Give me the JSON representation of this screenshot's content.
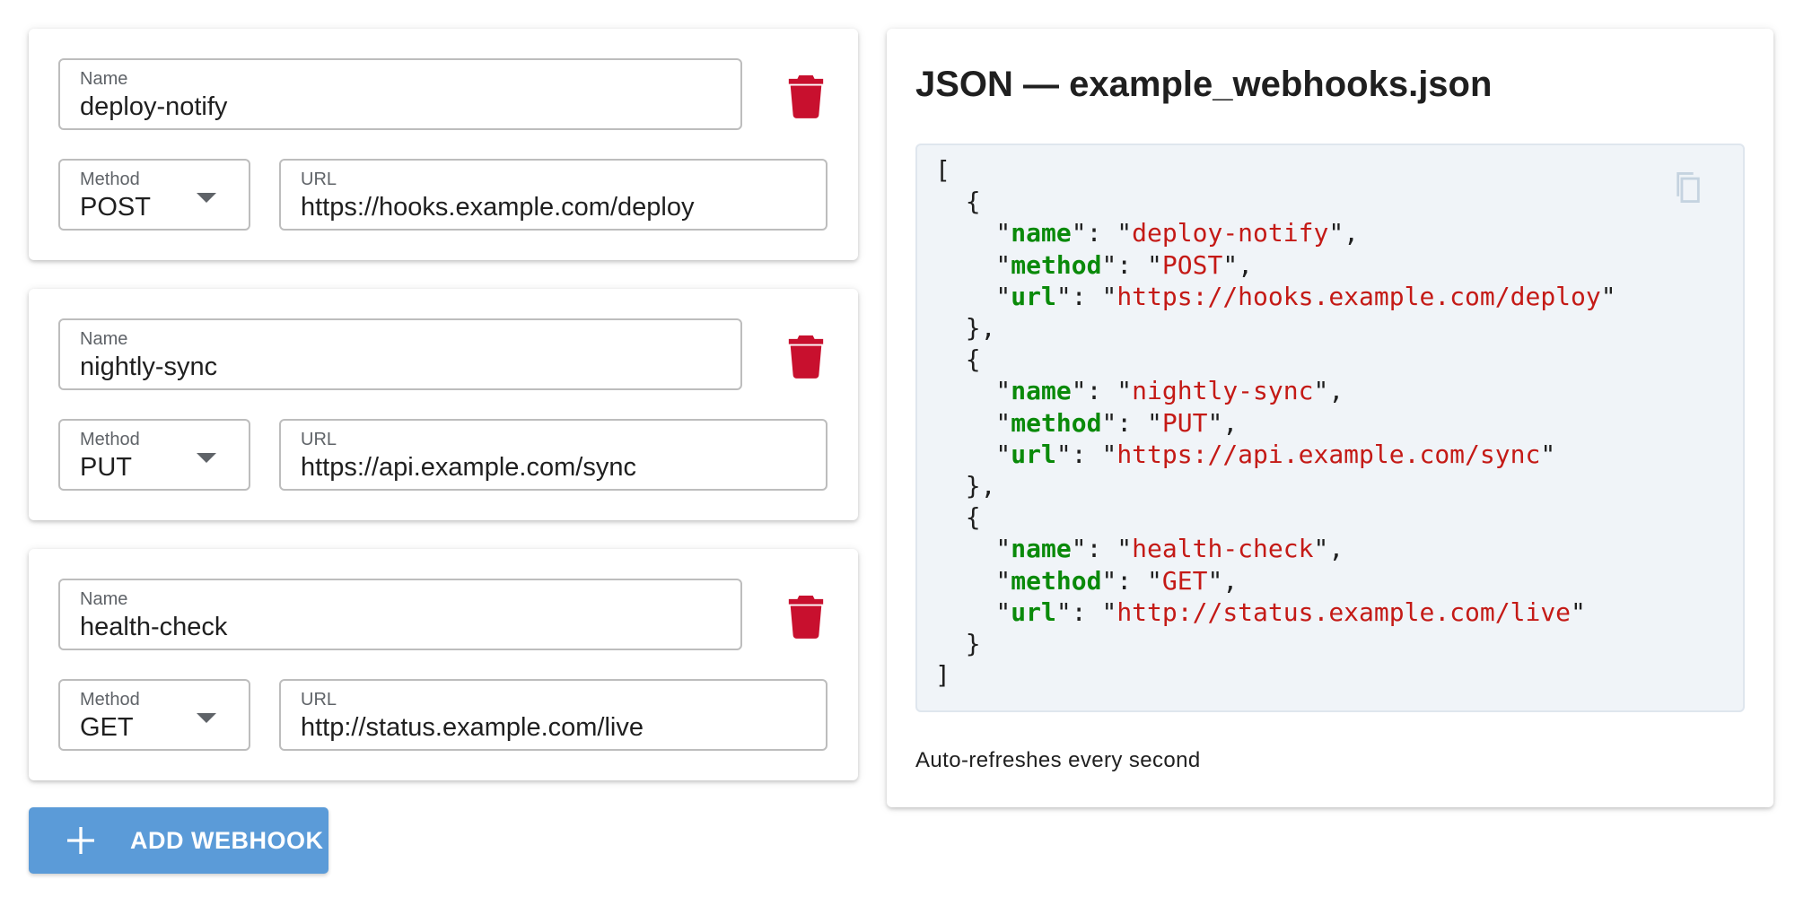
{
  "webhooks": [
    {
      "name_label": "Name",
      "name": "deploy-notify",
      "method_label": "Method",
      "method": "POST",
      "url_label": "URL",
      "url": "https://hooks.example.com/deploy"
    },
    {
      "name_label": "Name",
      "name": "nightly-sync",
      "method_label": "Method",
      "method": "PUT",
      "url_label": "URL",
      "url": "https://api.example.com/sync"
    },
    {
      "name_label": "Name",
      "name": "health-check",
      "method_label": "Method",
      "method": "GET",
      "url_label": "URL",
      "url": "http://status.example.com/live"
    }
  ],
  "add_button": {
    "label": "ADD WEBHOOK",
    "icon": "plus-icon"
  },
  "json_panel": {
    "title": "JSON — example_webhooks.json",
    "key_name": "name",
    "key_method": "method",
    "key_url": "url",
    "refresh_note": "Auto-refreshes every second",
    "copy_icon": "copy-icon"
  },
  "colors": {
    "accent": "#5b9bd8",
    "delete": "#c8102e",
    "json_key": "#0a8a0a",
    "json_string": "#c41a16",
    "code_bg": "#f0f4f8"
  }
}
